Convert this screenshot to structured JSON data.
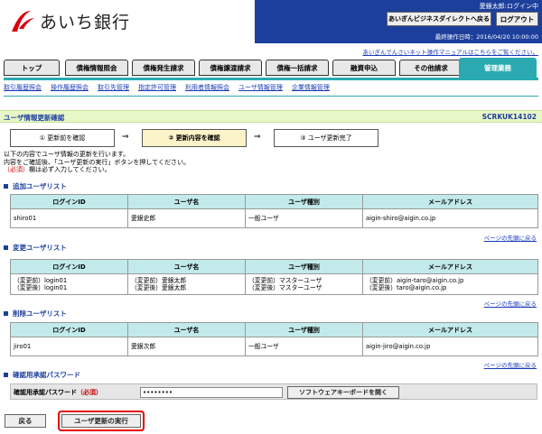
{
  "brand": {
    "name": "あいち銀行",
    "color": "#d7000f"
  },
  "header": {
    "user_status": "愛銀太郎:ログイン中",
    "direct_button": "あいぎんビジネスダイレクトへ戻る",
    "logout_button": "ログアウト",
    "last_login": "最終操作日時：2016/04/20 10:00:00",
    "manual_link": "あいぎんでんさいネット操作マニュアルはこちらをご覧ください。"
  },
  "tabs": [
    {
      "label": "トップ"
    },
    {
      "label": "債権情報照会"
    },
    {
      "label": "債権発生請求"
    },
    {
      "label": "債権譲渡請求"
    },
    {
      "label": "債権一括請求"
    },
    {
      "label": "融資申込"
    },
    {
      "label": "その他請求"
    },
    {
      "label": "管理業務"
    }
  ],
  "subnav": [
    "取引履歴照会",
    "操作履歴照会",
    "取引先管理",
    "指定許可管理",
    "利用者情報照会",
    "ユーザ情報管理",
    "企業情報管理"
  ],
  "page": {
    "title": "ユーザ情報更新確認",
    "code": "SCRKUK14102"
  },
  "steps": [
    {
      "label": "① 更新前を確認"
    },
    {
      "label": "② 更新内容を確認"
    },
    {
      "label": "③ ユーザ更新完了"
    }
  ],
  "step_arrow": "⇒",
  "instructions": {
    "line1": "以下の内容でユーザ情報の更新を行います。",
    "line2": "内容をご確認後、「ユーザ更新の実行」ボタンを押してください。",
    "required_mark": "（必須）",
    "line3_suffix": "欄は必ず入力してください。"
  },
  "columns": [
    "ログインID",
    "ユーザ名",
    "ユーザ種別",
    "メールアドレス"
  ],
  "sections": {
    "added": {
      "title": "追加ユーザリスト",
      "rows": [
        [
          "shiro01",
          "愛銀史郎",
          "一般ユーザ",
          "aigin-shiro@aigin.co.jp"
        ]
      ]
    },
    "changed": {
      "title": "変更ユーザリスト",
      "rows": [
        [
          "（変更前）login01\n（変更後）login01",
          "（変更前）愛銀太郎\n（変更後）愛銀太郎",
          "（変更前）マスターユーザ\n（変更後）マスターユーザ",
          "（変更前）aigin-taro@aigin.co.jp\n（変更後）taro@aigin.co.jp"
        ]
      ]
    },
    "deleted": {
      "title": "削除ユーザリスト",
      "rows": [
        [
          "jiro01",
          "愛銀次郎",
          "一般ユーザ",
          "aigin-jiro@aigin.co.jp"
        ]
      ]
    }
  },
  "page_top_link": "ページの先頭に戻る",
  "password": {
    "section_title": "確認用承認パスワード",
    "label": "確認用承認パスワード",
    "required": "（必須）",
    "value": "••••••••",
    "keyboard_button": "ソフトウェアキーボードを開く"
  },
  "buttons": {
    "back": "戻る",
    "execute": "ユーザ更新の実行"
  },
  "colors": {
    "header_blue": "#1d3f9c",
    "tab_active": "#2aaab0",
    "table_header": "#c2eaea",
    "highlight": "#e30000"
  }
}
